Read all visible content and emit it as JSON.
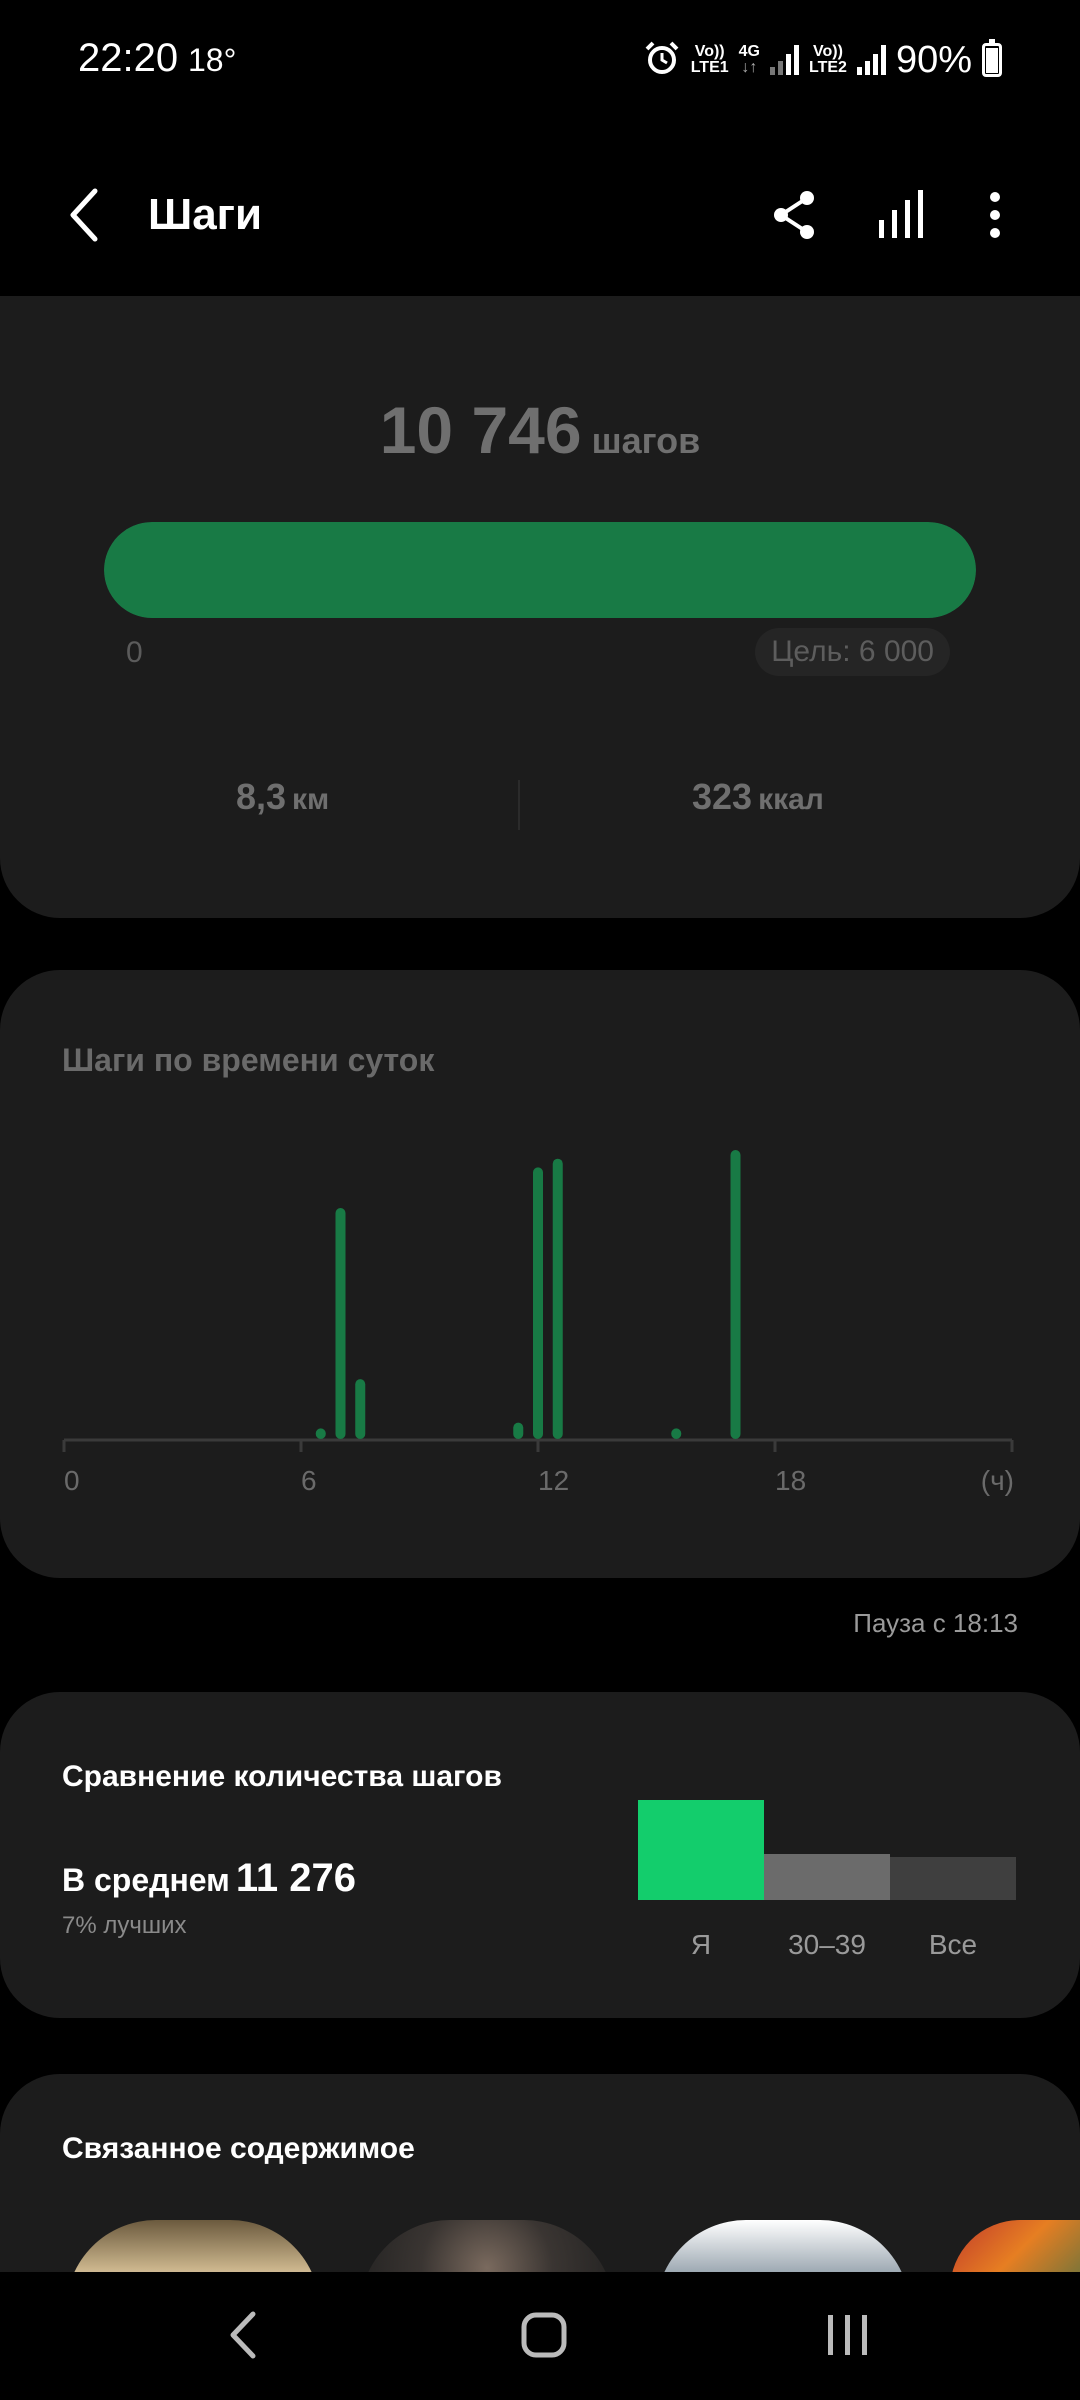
{
  "status": {
    "time": "22:20",
    "temp": "18°",
    "sim1_top": "Vo))",
    "sim1_bottom": "LTE1",
    "net_top": "4G",
    "net_bottom": "↓↑",
    "sim2_top": "Vo))",
    "sim2_bottom": "LTE2",
    "battery": "90%",
    "battery_level": 0.9
  },
  "header": {
    "title": "Шаги",
    "icons": [
      "back-icon",
      "share-icon",
      "bar-chart-icon",
      "more-icon"
    ]
  },
  "summary": {
    "steps": "10 746",
    "steps_unit": "шагов",
    "progress_fraction": 1.0,
    "min_label": "0",
    "goal_label": "Цель: 6 000",
    "distance": "8,3",
    "distance_unit": "км",
    "calories": "323",
    "calories_unit": "ккал",
    "accent_color": "#187a45"
  },
  "hourly": {
    "title": "Шаги по времени суток",
    "pause": "Пауза с 18:13"
  },
  "chart_data": {
    "type": "bar",
    "title": "Шаги по времени суток",
    "xlabel": "(ч)",
    "ylabel": "",
    "x_ticks": [
      "0",
      "6",
      "12",
      "18"
    ],
    "xlim": [
      0,
      24
    ],
    "ylim": [
      0,
      1
    ],
    "color": "#187a45",
    "bars": [
      {
        "x": 6.5,
        "value": 0.04
      },
      {
        "x": 7.0,
        "value": 0.8
      },
      {
        "x": 7.5,
        "value": 0.21
      },
      {
        "x": 11.5,
        "value": 0.06
      },
      {
        "x": 12.0,
        "value": 0.94
      },
      {
        "x": 12.5,
        "value": 0.97
      },
      {
        "x": 15.5,
        "value": 0.04
      },
      {
        "x": 17.0,
        "value": 1.0
      }
    ]
  },
  "compare": {
    "title": "Сравнение количества шагов",
    "avg_label": "В среднем",
    "avg_value": "11 276",
    "percentile": "7% лучших",
    "groups": [
      {
        "label": "Я",
        "value": 1.0,
        "color": "#13cd6c"
      },
      {
        "label": "30–39",
        "value": 0.46,
        "color": "#6b6b6b"
      },
      {
        "label": "Все",
        "value": 0.43,
        "color": "#3f3f3f"
      }
    ]
  },
  "related": {
    "title": "Связанное содержимое"
  }
}
